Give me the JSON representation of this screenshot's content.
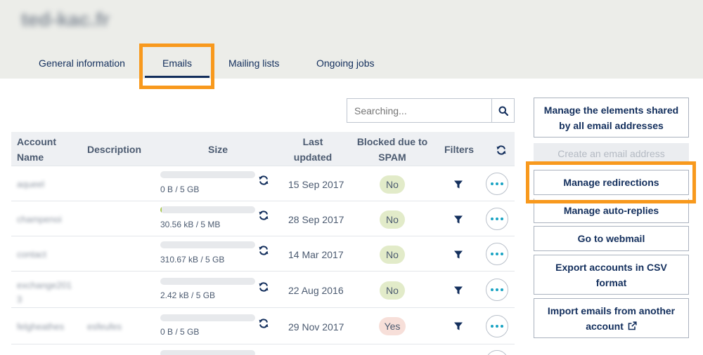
{
  "header": {
    "domain_title": "ted-kac.fr",
    "tabs": [
      {
        "label": "General information"
      },
      {
        "label": "Emails",
        "active": true
      },
      {
        "label": "Mailing lists"
      },
      {
        "label": "Ongoing jobs"
      }
    ]
  },
  "search": {
    "placeholder": "Searching..."
  },
  "table": {
    "columns": {
      "account_name": "Account Name",
      "description": "Description",
      "size": "Size",
      "last_updated": "Last updated",
      "blocked_spam": "Blocked due to SPAM",
      "filters": "Filters"
    },
    "rows": [
      {
        "account": "aqueel",
        "description": "",
        "size_text": "0 B / 5 GB",
        "usage": 0,
        "date": "15 Sep 2017",
        "spam": "No"
      },
      {
        "account": "champenoi",
        "description": "",
        "size_text": "30.56 kB / 5 MB",
        "usage": 0.006,
        "date": "28 Sep 2017",
        "spam": "No"
      },
      {
        "account": "contact",
        "description": "",
        "size_text": "310.67 kB / 5 GB",
        "usage": 0,
        "date": "14 Mar 2017",
        "spam": "No"
      },
      {
        "account": "exchange2013",
        "description": "",
        "size_text": "2.42 kB / 5 GB",
        "usage": 0,
        "date": "22 Aug 2016",
        "spam": "No"
      },
      {
        "account": "felgheathes",
        "description": "esfeufes",
        "size_text": "0 B / 5 GB",
        "usage": 0,
        "date": "29 Nov 2017",
        "spam": "Yes"
      }
    ]
  },
  "sidebar": {
    "buttons": [
      {
        "label": "Manage the elements shared by all email addresses"
      },
      {
        "label": "Create an email address",
        "disabled": true
      },
      {
        "label": "Manage redirections"
      },
      {
        "label": "Manage auto-replies"
      },
      {
        "label": "Go to webmail"
      },
      {
        "label": "Export accounts in CSV format"
      },
      {
        "label": "Import emails from another account"
      }
    ]
  },
  "colors": {
    "highlight": "#f8991d",
    "primary_text": "#122e5c",
    "accent": "#19a3c3",
    "badge_no": "#e2ebc9",
    "badge_yes": "#f7dfd9",
    "usage_bar": "#a8c94a"
  },
  "icons": {
    "search": "search-icon",
    "refresh": "refresh-icon",
    "filter": "filter-icon",
    "more": "more-options-icon",
    "external_link": "external-link-icon"
  }
}
